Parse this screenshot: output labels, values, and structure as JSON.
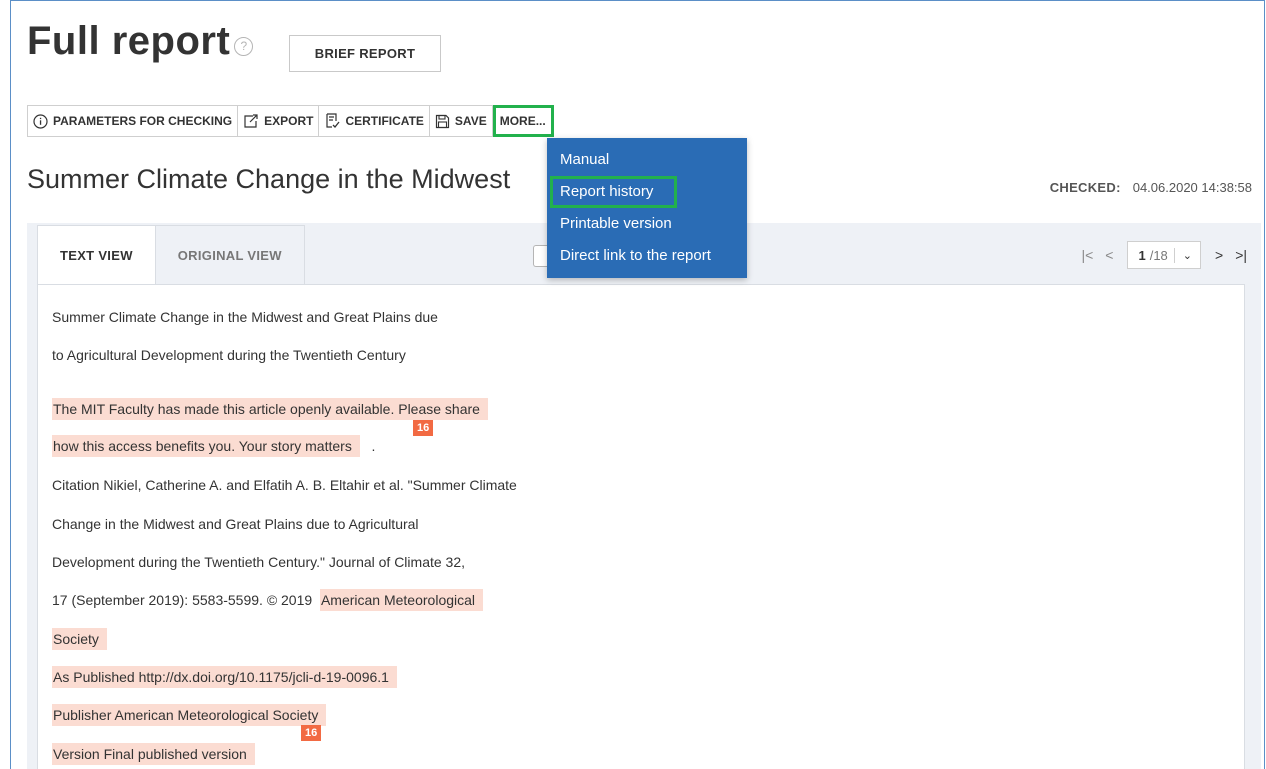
{
  "header": {
    "title": "Full report",
    "help_glyph": "?",
    "brief_button": "BRIEF REPORT"
  },
  "toolbar": {
    "parameters": "PARAMETERS FOR CHECKING",
    "export": "EXPORT",
    "certificate": "CERTIFICATE",
    "save": "SAVE",
    "more": "MORE..."
  },
  "more_menu": {
    "items": [
      "Manual",
      "Report history",
      "Printable version",
      "Direct link to the report"
    ],
    "selected": "Report history"
  },
  "document": {
    "title": "Summer Climate Change in the Midwest",
    "checked_label": "CHECKED:",
    "checked_value": "04.06.2020 14:38:58"
  },
  "tabs": [
    "TEXT VIEW",
    "ORIGINAL VIEW"
  ],
  "pager": {
    "current": "1",
    "total": "/18"
  },
  "content": {
    "lines": [
      "Summer Climate Change in the Midwest and Great Plains due",
      "to Agricultural Development during the Twentieth Century",
      "The MIT Faculty has made this article openly available. Please share",
      "how this access benefits you. Your story matters",
      ".",
      "Citation Nikiel, Catherine A. and Elfatih A. B. Eltahir et al. \"Summer Climate",
      "Change in the Midwest and Great Plains due to Agricultural",
      "Development during the Twentieth Century.\" Journal of Climate 32,",
      "17 (September 2019): 5583-5599. © 2019",
      "American Meteorological",
      "Society",
      "As Published http://dx.doi.org/10.1175/jcli-d-19-0096.1",
      "Publisher American Meteorological Society",
      "Version Final published version"
    ],
    "badges": [
      "16",
      "16"
    ]
  },
  "colors": {
    "accent": "#2a6cb5",
    "highlight": "#fbdcd2",
    "badge": "#f26a43",
    "annotation": "#22b14c"
  }
}
